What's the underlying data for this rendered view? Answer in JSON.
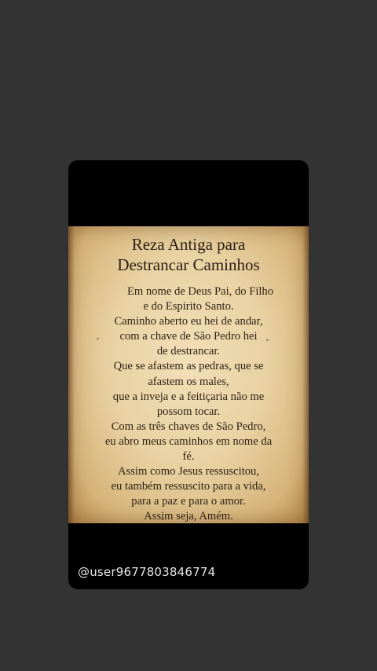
{
  "card": {
    "title_lines": [
      "Reza Antiga para",
      "Destrancar Caminhos"
    ],
    "prayer_lines": [
      "Em nome de Deus Pai, do Filho",
      "e do Espirito Santo.",
      "Caminho aberto eu hei de andar,",
      "com a chave de São Pedro hei",
      "de destrancar.",
      "Que se afastem as pedras, que se",
      "afastem os males,",
      "que a inveja e a feitiçaria não me",
      "possom tocar.",
      "Com as três chaves de São Pedro,",
      "eu abro meus caminhos em nome da",
      "fé.",
      "Assim como Jesus ressuscitou,",
      "eu também ressuscito para a vida,",
      "para a paz e para o amor.",
      "Assim seja, Amém."
    ],
    "watermark": "@user9677803846774"
  },
  "colors": {
    "page_background": "#333333",
    "card_background": "#000000",
    "parchment": "#e9d2a3",
    "ink": "#2a1c10"
  }
}
